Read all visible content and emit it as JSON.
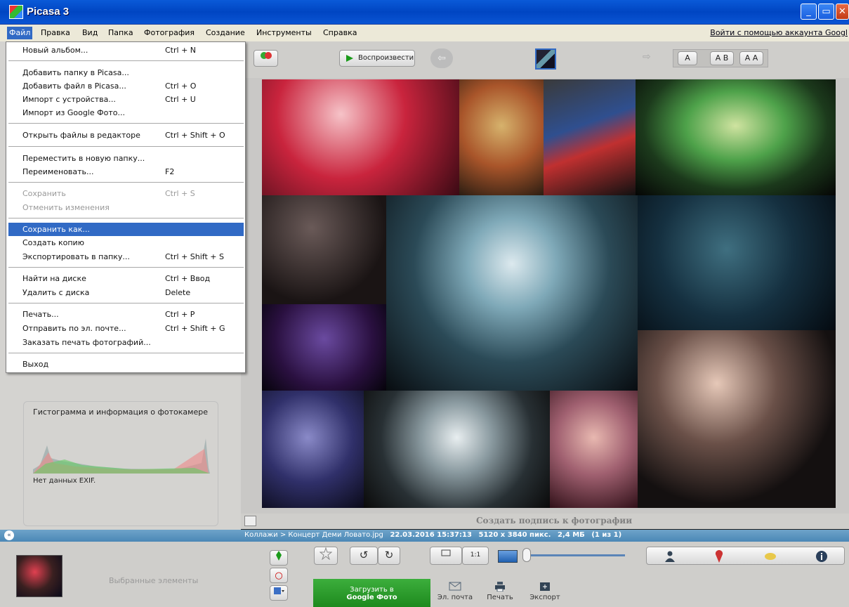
{
  "window": {
    "title": "Picasa 3",
    "buttons": [
      "_",
      "▭",
      "✕"
    ]
  },
  "menubar": {
    "items": [
      "Файл",
      "Правка",
      "Вид",
      "Папка",
      "Фотография",
      "Создание",
      "Инструменты",
      "Справка"
    ],
    "signin": "Войти с помощью аккаунта Googl"
  },
  "file_menu": {
    "rows": [
      {
        "label": "Новый альбом...",
        "shortcut": "Ctrl + N"
      },
      {
        "label": "Добавить папку в Picasa...",
        "shortcut": ""
      },
      {
        "label": "Добавить файл в Picasa...",
        "shortcut": "Ctrl + O"
      },
      {
        "label": "Импорт с устройства...",
        "shortcut": "Ctrl + U"
      },
      {
        "label": "Импорт из Google Фото...",
        "shortcut": ""
      },
      {
        "label": "Открыть файлы в редакторе",
        "shortcut": "Ctrl + Shift + O"
      },
      {
        "label": "Переместить в новую папку...",
        "shortcut": ""
      },
      {
        "label": "Переименовать...",
        "shortcut": "F2"
      },
      {
        "label": "Сохранить",
        "shortcut": "Ctrl + S"
      },
      {
        "label": "Отменить изменения",
        "shortcut": ""
      },
      {
        "label": "Сохранить как...",
        "shortcut": ""
      },
      {
        "label": "Создать копию",
        "shortcut": ""
      },
      {
        "label": "Экспортировать в папку...",
        "shortcut": "Ctrl + Shift + S"
      },
      {
        "label": "Найти на диске",
        "shortcut": "Ctrl + Ввод"
      },
      {
        "label": "Удалить с диска",
        "shortcut": "Delete"
      },
      {
        "label": "Печать...",
        "shortcut": "Ctrl + P"
      },
      {
        "label": "Отправить по эл. почте...",
        "shortcut": "Ctrl + Shift + G"
      },
      {
        "label": "Заказать печать фотографий...",
        "shortcut": ""
      },
      {
        "label": "Выход",
        "shortcut": ""
      }
    ]
  },
  "toolbar": {
    "play_label": "Воспроизвести",
    "layout_a": "A",
    "layout_ab": "A B",
    "layout_aa": "A A"
  },
  "histogram": {
    "title": "Гистограмма и информация о фотокамере",
    "no_exif": "Нет данных EXIF."
  },
  "caption": {
    "placeholder": "Создать подпись к фотографии"
  },
  "status": {
    "path": "Коллажи > Концерт Деми Ловато.jpg",
    "datetime": "22.03.2016 15:37:13",
    "dimensions": "5120 x 3840 пикс.",
    "size": "2,4 МБ",
    "position": "(1 из 1)"
  },
  "bottom": {
    "selected_label": "Выбранные элементы",
    "upload_line1": "Загрузить в",
    "upload_line2": "Google Фото",
    "email_label": "Эл. почта",
    "print_label": "Печать",
    "export_label": "Экспорт"
  },
  "colors": {
    "accent": "#316ac5",
    "upload_green": "#2e9a2e",
    "titlebar": "#0a55d4"
  }
}
